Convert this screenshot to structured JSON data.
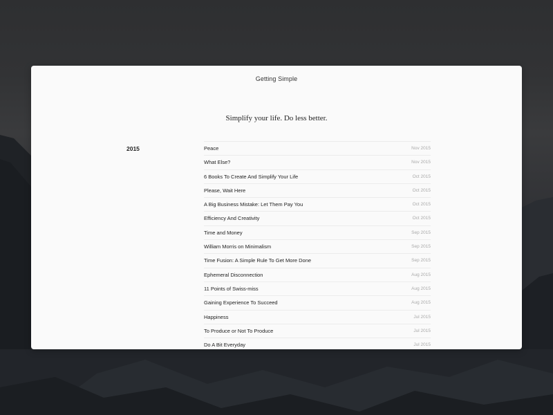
{
  "site": {
    "title": "Getting Simple",
    "tagline": "Simplify your life. Do less better."
  },
  "archive": {
    "year": "2015",
    "posts": [
      {
        "title": "Peace",
        "date": "Nov 2015"
      },
      {
        "title": "What Else?",
        "date": "Nov 2015"
      },
      {
        "title": "6 Books To Create And Simplify Your Life",
        "date": "Oct 2015"
      },
      {
        "title": "Please, Wait Here",
        "date": "Oct 2015"
      },
      {
        "title": "A Big Business Mistake: Let Them Pay You",
        "date": "Oct 2015"
      },
      {
        "title": "Efficiency And Creativity",
        "date": "Oct 2015"
      },
      {
        "title": "Time and Money",
        "date": "Sep 2015"
      },
      {
        "title": "William Morris on Minimalism",
        "date": "Sep 2015"
      },
      {
        "title": "Time Fusion: A Simple Rule To Get More Done",
        "date": "Sep 2015"
      },
      {
        "title": "Ephemeral Disconnection",
        "date": "Aug 2015"
      },
      {
        "title": "11 Points of Swiss-miss",
        "date": "Aug 2015"
      },
      {
        "title": "Gaining Experience To Succeed",
        "date": "Aug 2015"
      },
      {
        "title": "Happiness",
        "date": "Jul 2015"
      },
      {
        "title": "To Produce or Not To Produce",
        "date": "Jul 2015"
      },
      {
        "title": "Do A Bit Everyday",
        "date": "Jul 2015"
      }
    ]
  }
}
